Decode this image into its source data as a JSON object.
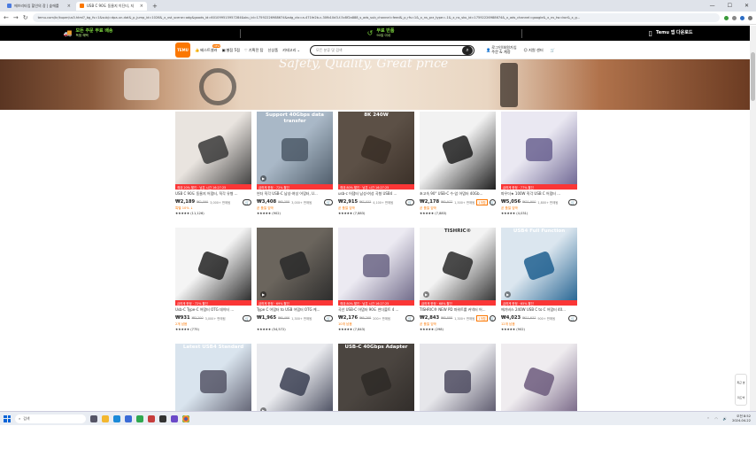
{
  "browser": {
    "tabs": [
      {
        "label": "에브리타임 할인의 장 | 숲에를",
        "active": false,
        "favicon_color": "#4a7be0"
      },
      {
        "label": "USB C 90도 동물지 이딘티, 지",
        "active": true,
        "favicon_color": "#fb7701"
      }
    ],
    "new_tab": "+",
    "url": "temu.com/kr/kuper/us3.html?_bg_fs=1&subj=dpa-un-dat&_p_jump_id=1026&_x_vst_scene=adg&goods_id=601099515957284&sku_id=17592226988674&adg_ctx=a-471fe2b-c-30fb10d3-f-5c8f2a888_s_ads_sub_channel=feed&_p_rfs=1&_x_ns_prz_type=-1&_x_ns_sku_id=17592226988674&_x_ads_channel=google&_x_ns_tw=kor&_x_g..."
  },
  "promo": {
    "items": [
      {
        "line1": "모든 주문 무료 배송",
        "line2": "독점 혜택",
        "icon": "truck-icon"
      },
      {
        "line1": "무료 반품",
        "line2": "90일 이내",
        "icon": "return-icon"
      },
      {
        "line1": "Temu 앱 다운로드",
        "line2": "",
        "icon": "phone-icon"
      }
    ]
  },
  "header": {
    "logo_text": "TEMU",
    "nav": [
      {
        "label": "베스트셀러",
        "badge": "NEW",
        "icon": "thumb-icon"
      },
      {
        "label": "별점 5점",
        "badge": "",
        "icon": "star-box-icon"
      },
      {
        "label": "기획전 탑",
        "badge": "",
        "icon": "heart-icon"
      },
      {
        "label": "신상품",
        "badge": "",
        "icon": ""
      },
      {
        "label": "카테고리",
        "badge": "",
        "icon": "chevron-down-icon"
      }
    ],
    "search_placeholder": "모든 분류 및 검색",
    "account_line1": "로그인/회원가입",
    "account_line2": "주문 & 계정",
    "support": "지원 센터",
    "cart": "🛒"
  },
  "banner": {
    "caption": "Safety, Quality, Great price"
  },
  "products": [
    {
      "title": "USB C 90도 동물지 어댑터, 직각 유형 ...",
      "price": "₩2,189",
      "orig": "₩2,090",
      "sold": "3,000+ 판매됨",
      "badge": "",
      "tag": "최대 20% 할인  ·  남은 시간 16:27:25",
      "note": "특별 10% ↓",
      "rating": "★★★★★ (11,126)",
      "bg": "#e9e4df",
      "dark": "#3a3a3a",
      "overlay": "",
      "video": false
    },
    {
      "title": "썬더 직각 USB-C 남성-여성 어댑터, U...",
      "price": "₩3,408",
      "orig": "₩8,388",
      "sold": "3,000+ 판매됨",
      "badge": "",
      "tag": "급하게 한정 · 72% 할인",
      "note": "곧 품절 임박",
      "rating": "★★★★★ (902)",
      "bg": "#a9b8c7",
      "dark": "#4c5967",
      "overlay": "Support 40Gbps data transfer",
      "video": true
    },
    {
      "title": "usb-c 어댑터 남성-여성 곡형 USB4 ...",
      "price": "₩2,915",
      "orig": "₩7,033",
      "sold": "4,100+ 판매됨",
      "badge": "",
      "tag": "최대 80% 할인  ·  남은 시간 16:27:25",
      "note": "곧 품절 임박",
      "rating": "★★★★★ (7,883)",
      "bg": "#5c5046",
      "dark": "#3a2f27",
      "overlay": "8K 240W",
      "video": false
    },
    {
      "title": "초고속 90° USB-C 수-암 어댑터 40Gb...",
      "price": "₩2,178",
      "orig": "₩5,977",
      "sold": "1,500+ 판매됨",
      "badge": "1개월",
      "tag": "",
      "note": "곧 품절 임박",
      "rating": "★★★★★ (7,883)",
      "bg": "#f2f2f2",
      "dark": "#1e1e1e",
      "overlay": "",
      "video": false
    },
    {
      "title": "파우더★ 100W 직각 USB C 어댑터 ...",
      "price": "₩5,056",
      "orig": "₩31,900",
      "sold": "1,800+ 판매됨",
      "badge": "",
      "tag": "급하게 한정 · 77% 할인",
      "note": "곧 품절 임박",
      "rating": "★★★★★ (4,031)",
      "bg": "#eae8f2",
      "dark": "#6a6290",
      "overlay": "",
      "video": false
    },
    {
      "title": "Usb-C Type-C 어댑터 OTG 데이터 ...",
      "price": "₩931",
      "orig": "₩3,200",
      "sold": "3,000+ 판매됨",
      "badge": "",
      "tag": "급하게 한정 · 72% 할인",
      "note": "2개 남음",
      "rating": "★★★★★ (775)",
      "bg": "#f4f4f4",
      "dark": "#222",
      "overlay": "",
      "video": false
    },
    {
      "title": "Type C 어댑터 to USB 어댑터 OTG 케...",
      "price": "₩1,965",
      "orig": "₩6,466",
      "sold": "1,300+ 판매됨",
      "badge": "",
      "tag": "급하게 한정 · 69% 할인",
      "note": "",
      "rating": "★★★★★ (54,572)",
      "bg": "#6b655d",
      "dark": "#2a2a2a",
      "overlay": "",
      "video": true
    },
    {
      "title": "곡선 USB-C 어댑터 90도 썬더볼트 4 ...",
      "price": "₩2,176",
      "orig": "₩6,268",
      "sold": "200+ 판매됨",
      "badge": "",
      "tag": "최대 80% 할인  ·  남은 시간 16:27:25",
      "note": "10개 남음",
      "rating": "★★★★★ (7,843)",
      "bg": "#eceaf2",
      "dark": "#6b6585",
      "overlay": "",
      "video": false
    },
    {
      "title": "TISHRIC® NEW PD 파워트롤 커넥터 어...",
      "price": "₩2,843",
      "orig": "₩8,888",
      "sold": "1,300+ 판매됨",
      "badge": "1개월",
      "tag": "급하게 한정 · 68% 할인",
      "note": "곧 품절 임박",
      "rating": "★★★★★ (298)",
      "bg": "#f3f3f3",
      "dark": "#2a2a2a",
      "overlay": "TISHRIC®",
      "video": true
    },
    {
      "title": "에기비스 240W USB C to C 어댑터 40...",
      "price": "₩4,023",
      "orig": "₩11,637",
      "sold": "900+ 판매됨",
      "badge": "",
      "tag": "급하게 한정 · 65% 할인",
      "note": "12개 남음",
      "rating": "★★★★★ (902)",
      "bg": "#dbe6ef",
      "dark": "#1f5f8f",
      "overlay": "USB4 Full Function",
      "video": true
    },
    {
      "title": "",
      "price": "",
      "orig": "",
      "sold": "",
      "badge": "",
      "tag": "",
      "note": "",
      "rating": "",
      "bg": "#d9e4ee",
      "dark": "#556",
      "overlay": "Latest USB4 Standard",
      "video": false
    },
    {
      "title": "",
      "price": "",
      "orig": "",
      "sold": "",
      "badge": "",
      "tag": "",
      "note": "",
      "rating": "",
      "bg": "#e9eaee",
      "dark": "#3b3f52",
      "overlay": "",
      "video": true
    },
    {
      "title": "",
      "price": "",
      "orig": "",
      "sold": "",
      "badge": "",
      "tag": "",
      "note": "",
      "rating": "",
      "bg": "#4b4540",
      "dark": "#2e2a27",
      "overlay": "USB-C 40Gbps Adapter",
      "video": false
    },
    {
      "title": "",
      "price": "",
      "orig": "",
      "sold": "",
      "badge": "",
      "tag": "",
      "note": "",
      "rating": "",
      "bg": "#e6e6ea",
      "dark": "#4e4b60",
      "overlay": "",
      "video": false
    },
    {
      "title": "",
      "price": "",
      "orig": "",
      "sold": "",
      "badge": "",
      "tag": "",
      "note": "",
      "rating": "",
      "bg": "#efecef",
      "dark": "#6c5a7c",
      "overlay": "",
      "video": false
    }
  ],
  "side_widget": {
    "top": "최근 본",
    "bottom": "피드백"
  },
  "taskbar": {
    "search_placeholder": "검색",
    "time": "오전 8:52",
    "date": "2024-04-22"
  }
}
